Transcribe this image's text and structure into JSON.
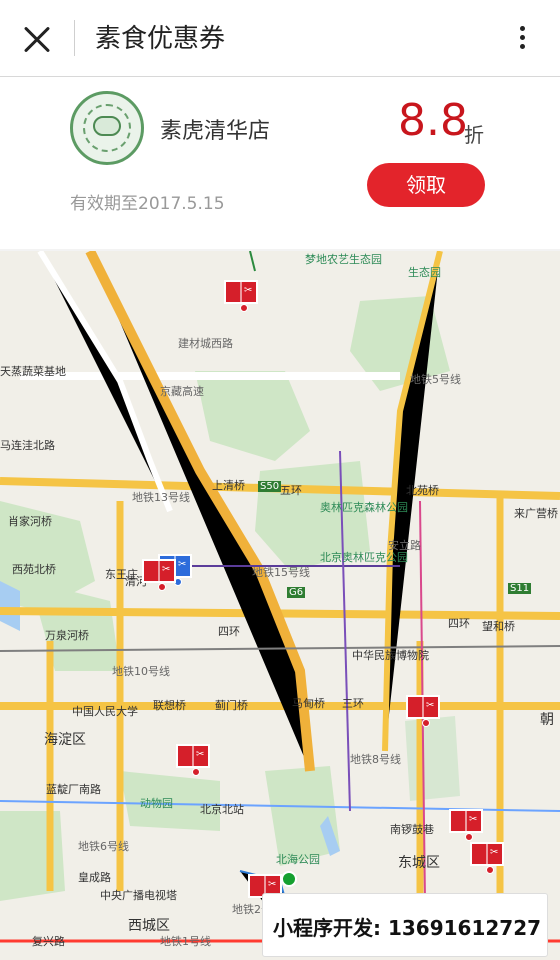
{
  "header": {
    "title": "素食优惠券",
    "close_icon": "close-icon",
    "more_icon": "more-icon"
  },
  "coupon": {
    "store_name": "素虎清华店",
    "discount": "8.8",
    "discount_unit": "折",
    "claim_button": "领取",
    "validity": "有效期至2017.5.15",
    "colors": {
      "accent": "#e3242b",
      "discount": "#c8161d",
      "muted": "#999999"
    }
  },
  "map": {
    "labels": [
      "梦地农艺生态园",
      "生态园",
      "建材城西路",
      "京藏高速",
      "东王庄",
      "清河",
      "上清桥",
      "五环",
      "北苑桥",
      "奥林匹克森林公园",
      "北京奥林匹克公园",
      "地铁15号线",
      "安立路",
      "地铁13号线",
      "肖家河桥",
      "西苑北桥",
      "四环",
      "万泉河桥",
      "望和桥",
      "四环",
      "中华民族博物院",
      "中国人民大学",
      "联想桥",
      "蓟门桥",
      "马甸桥",
      "三环",
      "海淀区",
      "北京北站",
      "动物园",
      "北海公园",
      "南锣鼓巷",
      "东城区",
      "皇成路",
      "中央广播电视塔",
      "西城区",
      "复兴路",
      "地铁1号线",
      "地铁6号线",
      "地铁10号线",
      "地铁2号线",
      "地铁5号线",
      "地铁8号线",
      "蓝靛厂南路",
      "来广营桥",
      "朝",
      "S50",
      "S11",
      "G6",
      "马连洼北路",
      "天蒸蔬菜基地"
    ],
    "marker_icon": "scissors-icon",
    "location_dot": "current-location-dot"
  },
  "overlay": {
    "text": "小程序开发: 13691612727"
  }
}
